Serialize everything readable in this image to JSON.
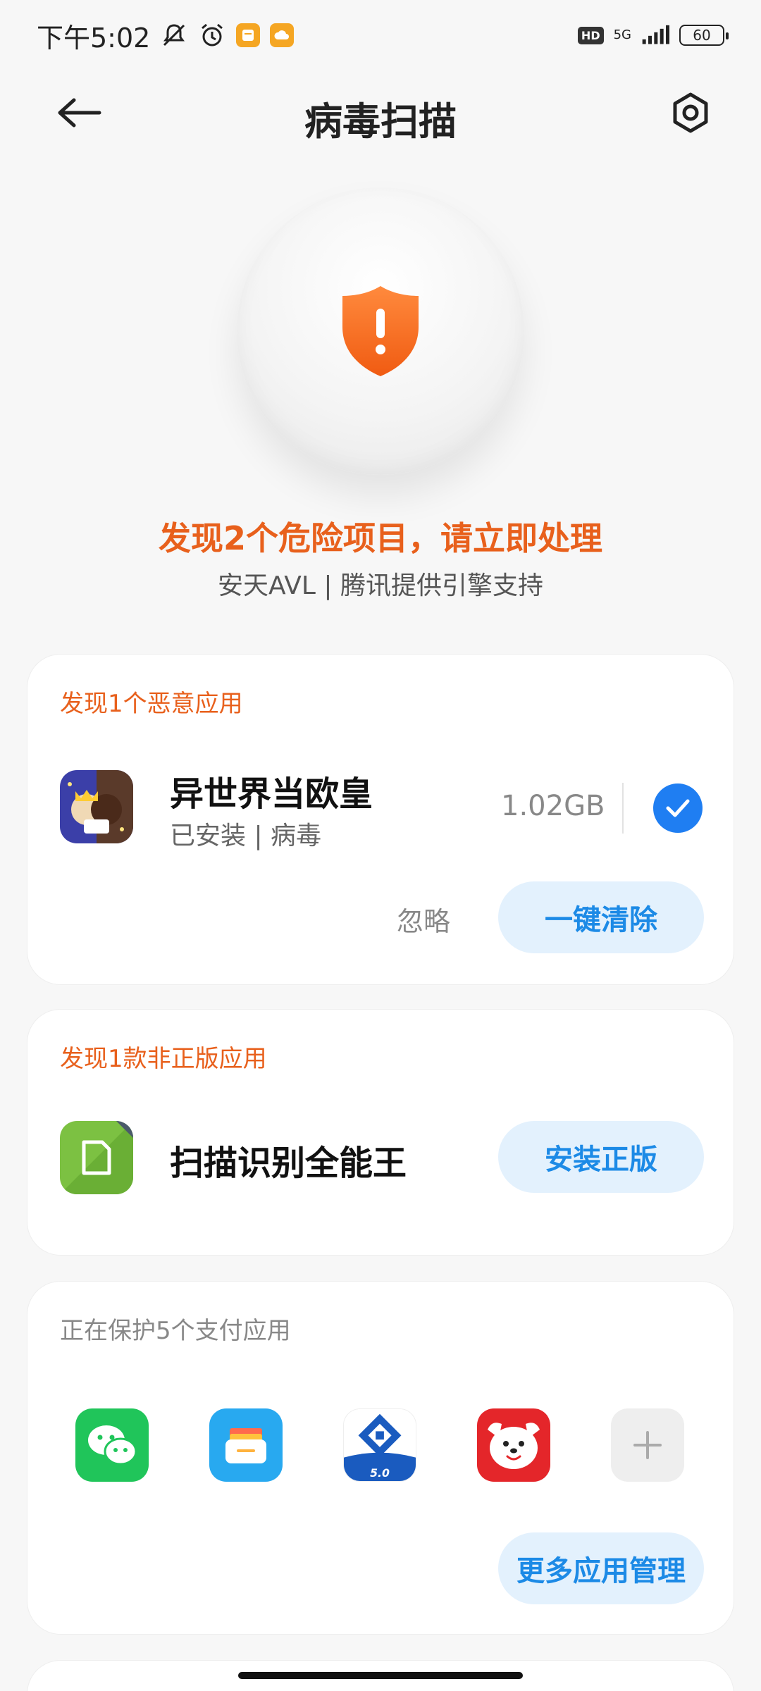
{
  "status_bar": {
    "time": "下午5:02",
    "hd": "HD",
    "network": "5G",
    "battery": "60"
  },
  "header": {
    "title": "病毒扫描"
  },
  "hero": {
    "message": "发现2个危险项目，请立即处理",
    "subtitle": "安天AVL | 腾讯提供引擎支持",
    "shield_color": "#f26a1b"
  },
  "malicious_card": {
    "title": "发现1个恶意应用",
    "app_name": "异世界当欧皇",
    "app_status": "已安装 | 病毒",
    "size": "1.02GB",
    "checked": true,
    "ignore_label": "忽略",
    "clean_label": "一键清除"
  },
  "pirated_card": {
    "title": "发现1款非正版应用",
    "app_name": "扫描识别全能王",
    "install_label": "安装正版"
  },
  "payment_card": {
    "title": "正在保护5个支付应用",
    "apps": [
      "wechat-icon",
      "wallet-icon",
      "ccb-bank-icon",
      "jd-icon",
      "add-icon"
    ],
    "bank_icon_version": "5.0",
    "more_label": "更多应用管理"
  },
  "colors": {
    "accent_orange": "#e8601c",
    "accent_blue": "#1c8ae6",
    "check_blue": "#1f7ef2"
  }
}
